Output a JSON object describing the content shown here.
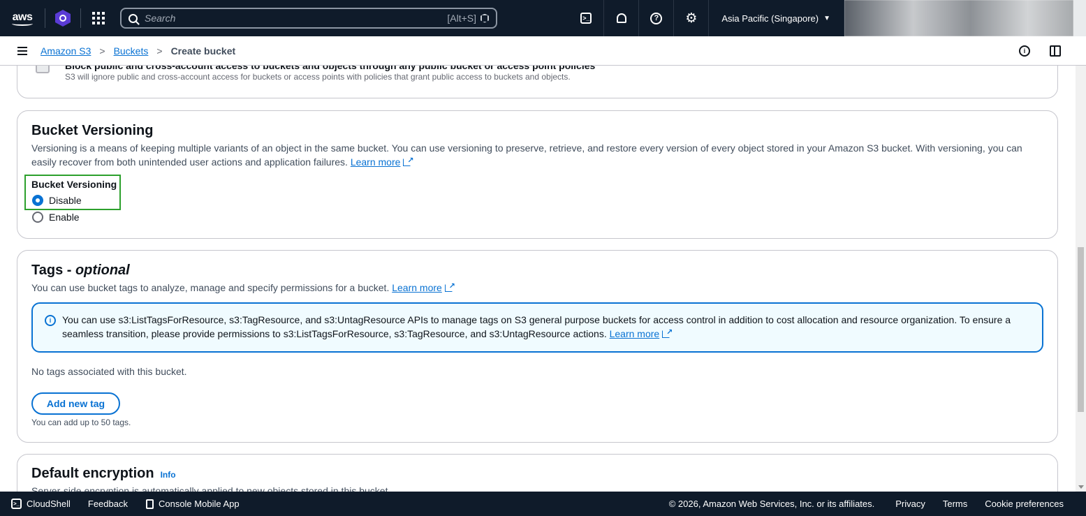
{
  "topnav": {
    "logo": "aws",
    "search_placeholder": "Search",
    "search_shortcut": "[Alt+S]",
    "region": "Asia Pacific (Singapore)"
  },
  "breadcrumb": {
    "items": [
      "Amazon S3",
      "Buckets"
    ],
    "current": "Create bucket"
  },
  "block_public_access": {
    "option_label": "Block public and cross-account access to buckets and objects through any public bucket or access point policies",
    "option_desc": "S3 will ignore public and cross-account access for buckets or access points with policies that grant public access to buckets and objects."
  },
  "versioning": {
    "title": "Bucket Versioning",
    "description": "Versioning is a means of keeping multiple variants of an object in the same bucket. You can use versioning to preserve, retrieve, and restore every version of every object stored in your Amazon S3 bucket. With versioning, you can easily recover from both unintended user actions and application failures.",
    "learn_more": "Learn more",
    "field_label": "Bucket Versioning",
    "options": [
      {
        "label": "Disable",
        "selected": true
      },
      {
        "label": "Enable",
        "selected": false
      }
    ]
  },
  "tags": {
    "title_main": "Tags - ",
    "title_optional": "optional",
    "description": "You can use bucket tags to analyze, manage and specify permissions for a bucket.",
    "learn_more": "Learn more",
    "alert_text": "You can use s3:ListTagsForResource, s3:TagResource, and s3:UntagResource APIs to manage tags on S3 general purpose buckets for access control in addition to cost allocation and resource organization. To ensure a seamless transition, please provide permissions to s3:ListTagsForResource, s3:TagResource, and s3:UntagResource actions.",
    "alert_learn_more": "Learn more",
    "empty_text": "No tags associated with this bucket.",
    "add_button": "Add new tag",
    "limit_text": "You can add up to 50 tags."
  },
  "encryption": {
    "title": "Default encryption",
    "info": "Info",
    "description": "Server-side encryption is automatically applied to new objects stored in this bucket."
  },
  "footer": {
    "cloudshell": "CloudShell",
    "feedback": "Feedback",
    "mobile_app": "Console Mobile App",
    "copyright": "© 2026, Amazon Web Services, Inc. or its affiliates.",
    "privacy": "Privacy",
    "terms": "Terms",
    "cookies": "Cookie preferences"
  },
  "colors": {
    "nav_bg": "#0f1b2a",
    "link": "#0972d3",
    "highlight_box": "#2ca02c"
  }
}
